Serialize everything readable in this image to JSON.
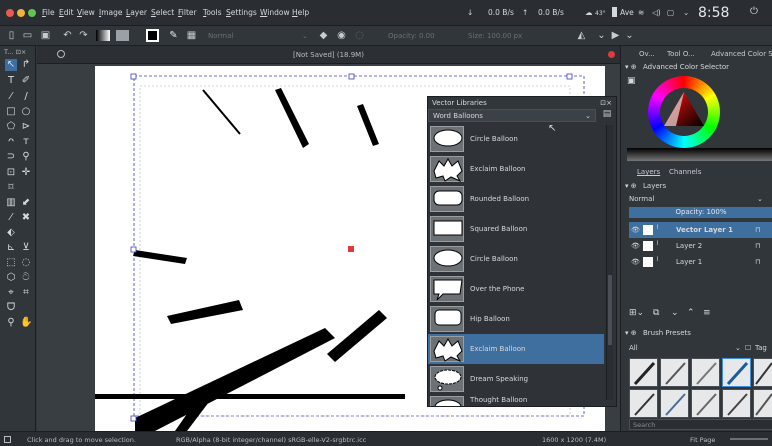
{
  "menu": [
    "File",
    "Edit",
    "View",
    "Image",
    "Layer",
    "Select",
    "Filter",
    "Tools",
    "Settings",
    "Window",
    "Help"
  ],
  "system": {
    "download_rate": "0.0 B/s",
    "upload_rate": "0.0 B/s",
    "temperature": "43°",
    "battery": "Ave",
    "clock": "8:58"
  },
  "toolbar": {
    "blend_mode": "Normal",
    "opacity_label": "Opacity: 0.00",
    "size_label": "Size: 100.00 px"
  },
  "canvas": {
    "title": "[Not Saved]  (18.9M)"
  },
  "vector_libraries": {
    "title": "Vector Libraries",
    "selected_library": "Word Balloons",
    "items": [
      {
        "label": "Circle Balloon"
      },
      {
        "label": "Exclaim Balloon"
      },
      {
        "label": "Rounded Balloon"
      },
      {
        "label": "Squared Balloon"
      },
      {
        "label": "Circle Balloon"
      },
      {
        "label": "Over the Phone"
      },
      {
        "label": "Hip Balloon"
      },
      {
        "label": "Exclaim Balloon"
      },
      {
        "label": "Dream Speaking"
      },
      {
        "label": "Thought Balloon"
      }
    ],
    "selected_index": 7
  },
  "right_panel": {
    "tabs": [
      "Ov...",
      "Tool O...",
      "Advanced Color S"
    ],
    "color_selector_title": "Advanced Color Selector",
    "layer_tabs": [
      "Layers",
      "Channels"
    ],
    "layers_header": "Layers",
    "blend_mode": "Normal",
    "opacity": "Opacity:  100%",
    "layers": [
      {
        "name": "Vector Layer 1",
        "selected": true
      },
      {
        "name": "Layer 2",
        "selected": false
      },
      {
        "name": "Layer 1",
        "selected": false
      }
    ],
    "brush_presets_title": "Brush Presets",
    "brush_filter": "All",
    "tag_label": "Tag",
    "search_placeholder": "Search"
  },
  "status": {
    "hint": "Click and drag to move selection.",
    "color_info": "RGB/Alpha (8-bit integer/channel)  sRGB-elle-V2-srgbtrc.icc",
    "dimensions": "1600 x 1200 (7.4M)",
    "zoom_mode": "Fit Page"
  },
  "colors": {
    "accent": "#3f6f9f",
    "window_bg": "#31363b",
    "handle_red": "#e0393e"
  }
}
